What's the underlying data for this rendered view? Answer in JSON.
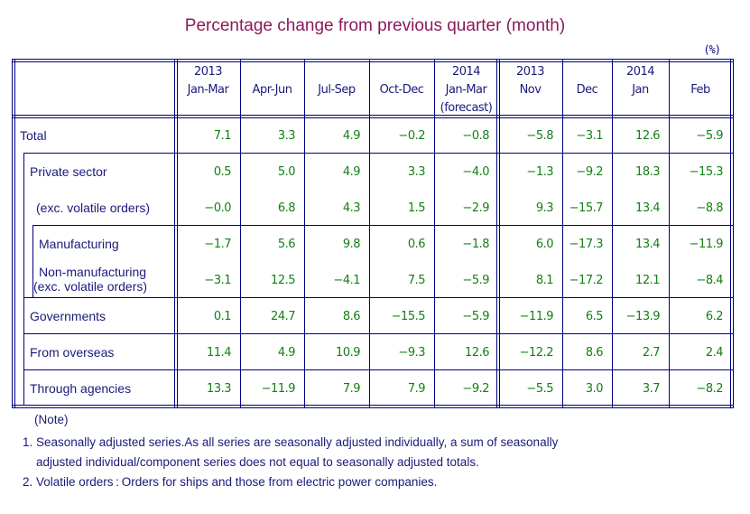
{
  "title": "Percentage change from previous quarter (month)",
  "unit": "(%)",
  "columns": [
    {
      "year": "2013",
      "period": "Jan-Mar",
      "note": ""
    },
    {
      "year": "",
      "period": "Apr-Jun",
      "note": ""
    },
    {
      "year": "",
      "period": "Jul-Sep",
      "note": ""
    },
    {
      "year": "",
      "period": "Oct-Dec",
      "note": ""
    },
    {
      "year": "2014",
      "period": "Jan-Mar",
      "note": "(forecast)"
    },
    {
      "year": "2013",
      "period": "Nov",
      "note": ""
    },
    {
      "year": "",
      "period": "Dec",
      "note": ""
    },
    {
      "year": "2014",
      "period": "Jan",
      "note": ""
    },
    {
      "year": "",
      "period": "Feb",
      "note": ""
    }
  ],
  "rows": [
    {
      "label": "Total",
      "label2": "",
      "values": [
        "7.1",
        "3.3",
        "4.9",
        "−0.2",
        "−0.8",
        "−5.8",
        "−3.1",
        "12.6",
        "−5.9"
      ]
    },
    {
      "label": "Private sector",
      "label2": "",
      "values": [
        "0.5",
        "5.0",
        "4.9",
        "3.3",
        "−4.0",
        "−1.3",
        "−9.2",
        "18.3",
        "−15.3"
      ]
    },
    {
      "label": "(exc. volatile orders)",
      "label2": "",
      "values": [
        "−0.0",
        "6.8",
        "4.3",
        "1.5",
        "−2.9",
        "9.3",
        "−15.7",
        "13.4",
        "−8.8"
      ]
    },
    {
      "label": "Manufacturing",
      "label2": "",
      "values": [
        "−1.7",
        "5.6",
        "9.8",
        "0.6",
        "−1.8",
        "6.0",
        "−17.3",
        "13.4",
        "−11.9"
      ]
    },
    {
      "label": "Non-manufacturing",
      "label2": "(exc. volatile orders)",
      "values": [
        "−3.1",
        "12.5",
        "−4.1",
        "7.5",
        "−5.9",
        "8.1",
        "−17.2",
        "12.1",
        "−8.4"
      ]
    },
    {
      "label": "Governments",
      "label2": "",
      "values": [
        "0.1",
        "24.7",
        "8.6",
        "−15.5",
        "−5.9",
        "−11.9",
        "6.5",
        "−13.9",
        "6.2"
      ]
    },
    {
      "label": "From overseas",
      "label2": "",
      "values": [
        "11.4",
        "4.9",
        "10.9",
        "−9.3",
        "12.6",
        "−12.2",
        "8.6",
        "2.7",
        "2.4"
      ]
    },
    {
      "label": "Through agencies",
      "label2": "",
      "values": [
        "13.3",
        "−11.9",
        "7.9",
        "7.9",
        "−9.2",
        "−5.5",
        "3.0",
        "3.7",
        "−8.2"
      ]
    }
  ],
  "notes": {
    "heading": "(Note)",
    "line1": "1. Seasonally adjusted series.As all series are seasonally adjusted individually,  a sum of seasonally",
    "line1b": "adjusted individual/component series does not equal to seasonally adjusted totals.",
    "line2": "2. Volatile orders : Orders for ships and those from electric power companies."
  },
  "colors": {
    "title": "#8b1a5a",
    "border": "#000080",
    "values": "#138013",
    "labels": "#1a1a7a"
  }
}
